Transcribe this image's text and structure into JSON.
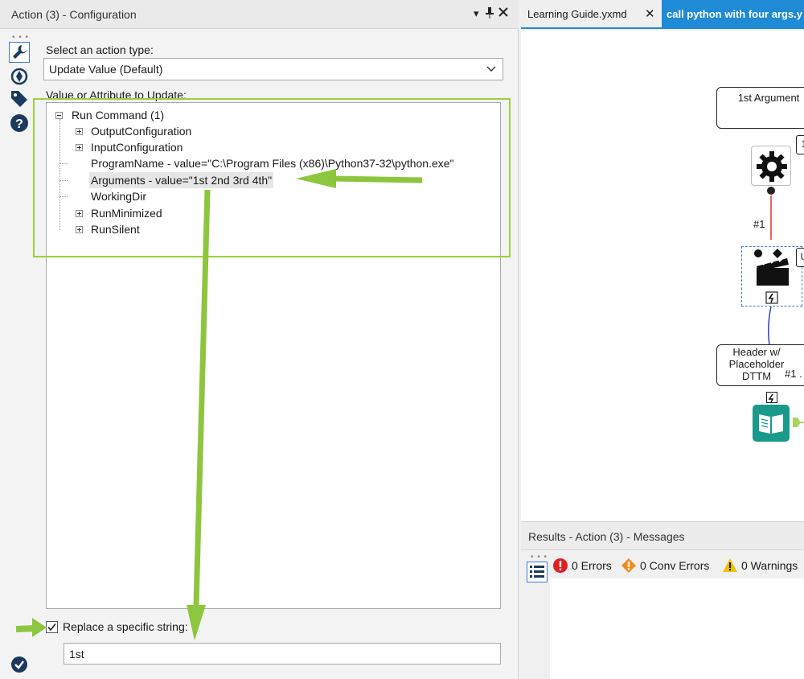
{
  "config_panel": {
    "title": "Action (3) - Configuration",
    "pin_glyph": "▾ ✚ ✕",
    "select_label": "Select an action type:",
    "select_value": "Update Value (Default)",
    "value_label": "Value or Attribute to Update:",
    "tree": {
      "root": "Run Command (1)",
      "children": [
        "OutputConfiguration",
        "InputConfiguration",
        "ProgramName - value=\"C:\\Program Files (x86)\\Python37-32\\python.exe\"",
        "Arguments - value=\"1st 2nd 3rd 4th\"",
        "WorkingDir",
        "RunMinimized",
        "RunSilent"
      ]
    },
    "replace_label": "Replace a specific string:",
    "replace_checked": true,
    "replace_value": "1st",
    "toolbar_icons": [
      "wrench-icon",
      "target-icon",
      "tag-icon",
      "help-icon"
    ]
  },
  "tabs": {
    "tab1": "Learning Guide.yxmd",
    "tab1_close": "✕",
    "tab2": "call python with four args.y"
  },
  "canvas": {
    "box1_label": "1st Argument",
    "side_tag1": "1",
    "edge_label1": "#1",
    "side_tag2": "U",
    "box2_label": "Header w/ Placeholder DTTM",
    "edge_label2": "#1 ."
  },
  "results": {
    "title": "Results - Action (3) - Messages",
    "errors": "0 Errors",
    "conv_errors": "0 Conv Errors",
    "warnings": "0 Warnings"
  },
  "colors": {
    "accent_blue": "#1f8ad6",
    "highlight_green": "#8cc63f",
    "error_red": "#e02020",
    "conv_orange": "#f08c1c",
    "warning_yellow": "#f2c200",
    "tool_teal": "#1a9a8a"
  }
}
